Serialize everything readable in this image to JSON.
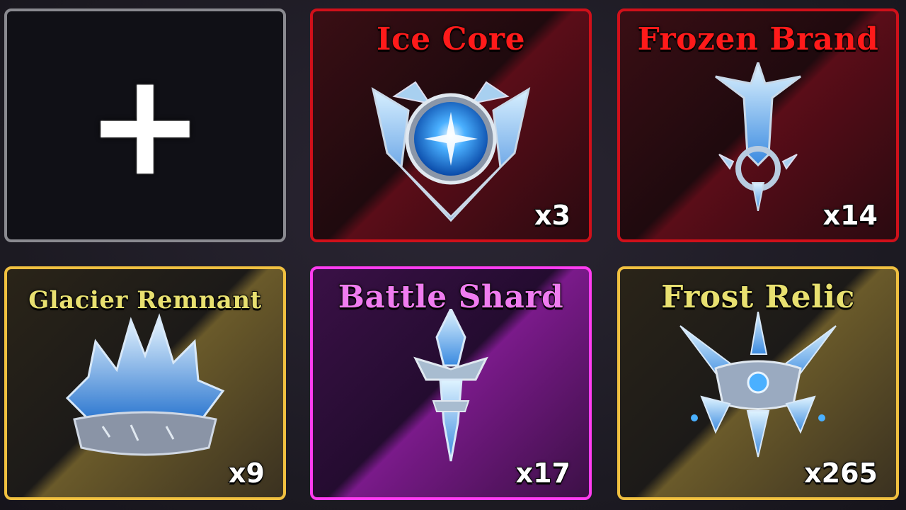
{
  "inventory": {
    "empty_slot": {
      "icon": "plus-icon",
      "glyph": "+"
    },
    "items": [
      {
        "name": "Ice Core",
        "count": "x3",
        "rarity": "red",
        "icon": "ice-core-icon"
      },
      {
        "name": "Frozen Brand",
        "count": "x14",
        "rarity": "red",
        "icon": "frozen-brand-icon"
      },
      {
        "name": "Glacier Remnant",
        "count": "x9",
        "rarity": "gold",
        "icon": "glacier-remnant-icon"
      },
      {
        "name": "Battle Shard",
        "count": "x17",
        "rarity": "purple",
        "icon": "battle-shard-icon"
      },
      {
        "name": "Frost Relic",
        "count": "x265",
        "rarity": "gold",
        "icon": "frost-relic-icon"
      }
    ]
  },
  "colors": {
    "red_rarity": "#d0101a",
    "gold_rarity": "#f0c040",
    "purple_rarity": "#ff3cf0",
    "empty_border": "#8a8a90",
    "ice": "#4aa8ff"
  }
}
